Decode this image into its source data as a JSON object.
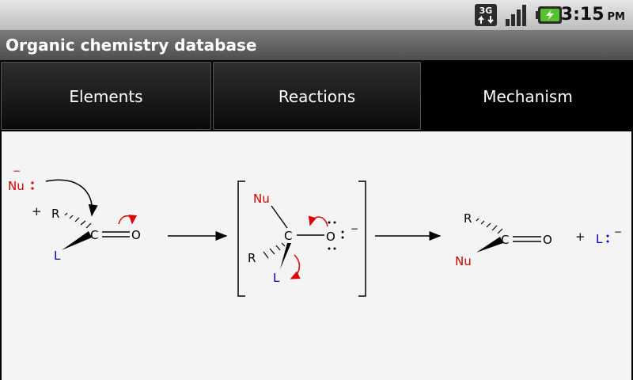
{
  "status_bar": {
    "network_type": "3G",
    "time": "3:15",
    "ampm": "PM",
    "icons": [
      "3g-data-icon",
      "signal-strength-icon",
      "battery-charging-icon"
    ]
  },
  "app": {
    "title": "Organic chemistry database"
  },
  "tabs": [
    {
      "label": "Elements",
      "selected": false
    },
    {
      "label": "Reactions",
      "selected": false
    },
    {
      "label": "Mechanism",
      "selected": true
    }
  ],
  "mechanism": {
    "reactant": {
      "nucleophile": "Nu",
      "nucleophile_charge": "−",
      "plus": "+",
      "r_group": "R",
      "leaving_group": "L",
      "carbon": "C",
      "oxygen": "O"
    },
    "intermediate": {
      "nucleophile": "Nu",
      "r_group": "R",
      "leaving_group": "L",
      "carbon": "C",
      "oxygen": "O",
      "oxygen_charge": "−"
    },
    "product": {
      "r_group": "R",
      "nucleophile": "Nu",
      "carbon": "C",
      "oxygen": "O",
      "plus": "+",
      "leaving_group": "L",
      "leaving_group_charge": "−"
    },
    "colors": {
      "nucleophile": "#cc0000",
      "leaving_group": "#0000cc",
      "arrow_red": "#dd0000",
      "bond": "#000000"
    }
  }
}
